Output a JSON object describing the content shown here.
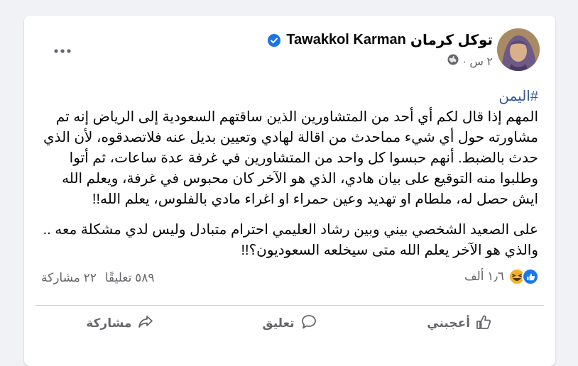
{
  "author": {
    "name_arabic": "توكل كرمان",
    "name_latin": "Tawakkol Karman",
    "verified": true
  },
  "meta": {
    "time": "٢ س ·",
    "audience_icon": "globe-icon"
  },
  "post": {
    "hashtag": "#اليمن",
    "paragraph1": "المهم إذا قال لكم أي أحد من المتشاورين الذين ساقتهم السعودية إلى الرياض إنه  تم مشاورته حول أي شيء مماحدث من اقالة لهادي وتعيين بديل عنه فلاتصدقوه، لأن الذي حدث بالضبط. أنهم حبسوا كل واحد من المتشاورين في غرفة عدة ساعات، ثم أتوا وطلبوا منه التوقيع على بيان هادي، الذي هو الآخر  كان محبوس في غرفة، ويعلم الله ايش حصل له، ملطام او تهديد وعين حمراء او اغراء مادي بالفلوس، يعلم الله!!",
    "paragraph2": "على الصعيد الشخصي بيني وبين رشاد العليمي احترام متبادل وليس لدي مشكلة معه .. والذي هو الآخر يعلم الله متى سيخلعه السعوديون؟!!"
  },
  "stats": {
    "reactions_count": "١٫٦ ألف",
    "comments": "٥٨٩ تعليقًا",
    "shares": "٢٢ مشاركة"
  },
  "actions": {
    "like": "أعجبني",
    "comment": "تعليق",
    "share": "مشاركة"
  },
  "colors": {
    "background": "#f0f2f5",
    "card": "#ffffff",
    "hashtag": "#385898",
    "secondary_text": "#65676b",
    "verified_badge": "#1b74e4",
    "like_blue": "#1877f2",
    "haha_yellow": "#f7b125"
  }
}
